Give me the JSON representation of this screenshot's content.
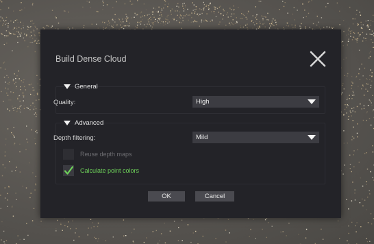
{
  "dialog": {
    "title": "Build Dense Cloud",
    "close_icon": "close-x-icon"
  },
  "general": {
    "header": "General",
    "quality_label": "Quality:",
    "quality_value": "High"
  },
  "advanced": {
    "header": "Advanced",
    "depth_filtering_label": "Depth filtering:",
    "depth_filtering_value": "Mild",
    "reuse_depth_maps_label": "Reuse depth maps",
    "reuse_depth_maps_checked": false,
    "reuse_depth_maps_enabled": false,
    "calculate_point_colors_label": "Calculate point colors",
    "calculate_point_colors_checked": true
  },
  "buttons": {
    "ok_label": "OK",
    "cancel_label": "Cancel"
  },
  "colors": {
    "dialog_bg": "#232328",
    "accent_green": "#6ed25a",
    "disabled_text": "#6c6c70",
    "combo_bg": "#3c3c42",
    "button_bg": "#4a4a50"
  }
}
